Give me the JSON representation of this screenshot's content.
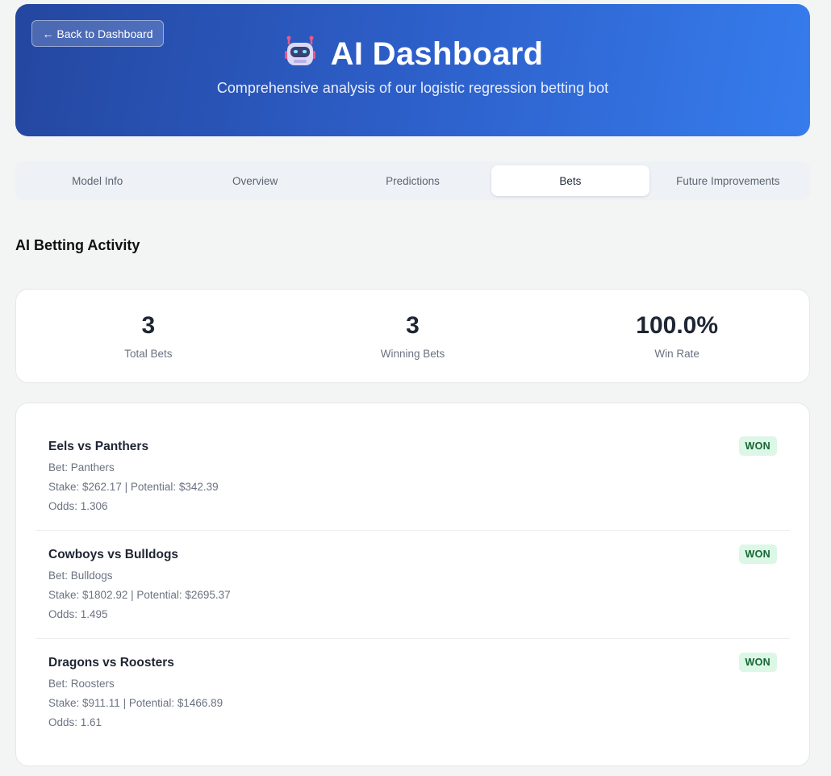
{
  "header": {
    "back_label": "← Back to Dashboard",
    "title": "AI Dashboard",
    "subtitle": "Comprehensive analysis of our logistic regression betting bot",
    "icon": "robot-icon",
    "gradient_start": "#2447a0",
    "gradient_end": "#367ced"
  },
  "tabs": [
    {
      "label": "Model Info",
      "active": false
    },
    {
      "label": "Overview",
      "active": false
    },
    {
      "label": "Predictions",
      "active": false
    },
    {
      "label": "Bets",
      "active": true
    },
    {
      "label": "Future Improvements",
      "active": false
    }
  ],
  "section_title": "AI Betting Activity",
  "stats": [
    {
      "value": "3",
      "label": "Total Bets"
    },
    {
      "value": "3",
      "label": "Winning Bets"
    },
    {
      "value": "100.0%",
      "label": "Win Rate"
    }
  ],
  "bets": [
    {
      "match": "Eels vs Panthers",
      "bet": "Bet: Panthers",
      "stake": "Stake: $262.17 | Potential: $342.39",
      "odds": "Odds: 1.306",
      "status": "WON"
    },
    {
      "match": "Cowboys vs Bulldogs",
      "bet": "Bet: Bulldogs",
      "stake": "Stake: $1802.92 | Potential: $2695.37",
      "odds": "Odds: 1.495",
      "status": "WON"
    },
    {
      "match": "Dragons vs Roosters",
      "bet": "Bet: Roosters",
      "stake": "Stake: $911.11 | Potential: $1466.89",
      "odds": "Odds: 1.61",
      "status": "WON"
    }
  ],
  "colors": {
    "won_bg": "#dcf7e6",
    "won_text": "#166534"
  }
}
